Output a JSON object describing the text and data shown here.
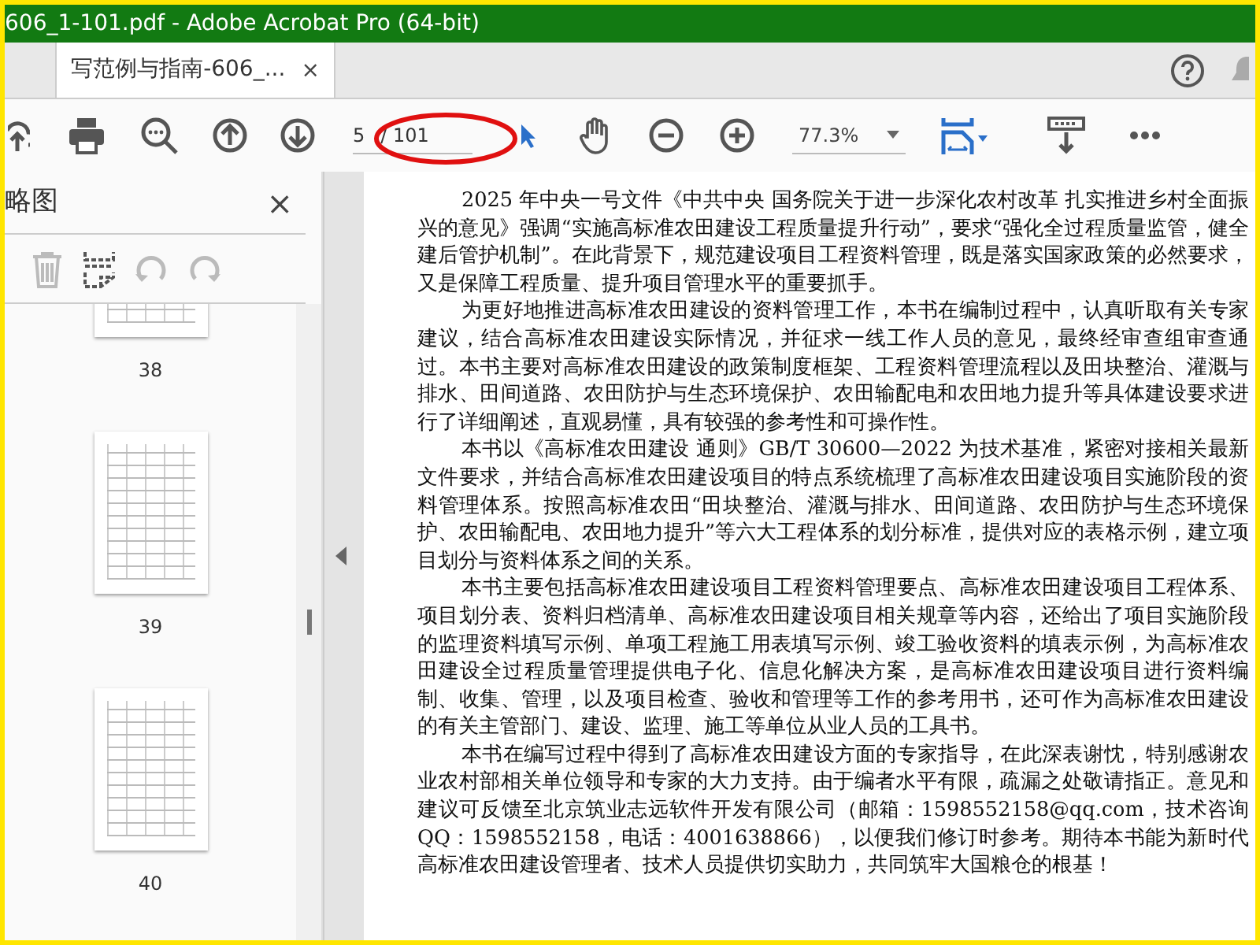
{
  "window": {
    "title": "606_1-101.pdf - Adobe Acrobat Pro (64-bit)"
  },
  "tabs": [
    {
      "label": "写范例与指南-606_...",
      "selected": true,
      "close": "×"
    }
  ],
  "toolbar": {
    "page_number": "5",
    "page_total": "/ 101",
    "zoom": "77.3%"
  },
  "thumbnail_panel": {
    "title": "略图",
    "close": "×",
    "thumbnails": [
      {
        "label": "38"
      },
      {
        "label": "39"
      },
      {
        "label": "40"
      }
    ]
  },
  "document": {
    "paragraphs": [
      "2025 年中央一号文件《中共中央  国务院关于进一步深化农村改革  扎实推进乡村全面振兴的意见》强调“实施高标准农田建设工程质量提升行动”，要求“强化全过程质量监管，健全建后管护机制”。在此背景下，规范建设项目工程资料管理，既是落实国家政策的必然要求，又是保障工程质量、提升项目管理水平的重要抓手。",
      "为更好地推进高标准农田建设的资料管理工作，本书在编制过程中，认真听取有关专家建议，结合高标准农田建设实际情况，并征求一线工作人员的意见，最终经审查组审查通过。本书主要对高标准农田建设的政策制度框架、工程资料管理流程以及田块整治、灌溉与排水、田间道路、农田防护与生态环境保护、农田输配电和农田地力提升等具体建设要求进行了详细阐述，直观易懂，具有较强的参考性和可操作性。",
      "本书以《高标准农田建设  通则》GB/T 30600—2022 为技术基准，紧密对接相关最新文件要求，并结合高标准农田建设项目的特点系统梳理了高标准农田建设项目实施阶段的资料管理体系。按照高标准农田“田块整治、灌溉与排水、田间道路、农田防护与生态环境保护、农田输配电、农田地力提升”等六大工程体系的划分标准，提供对应的表格示例，建立项目划分与资料体系之间的关系。",
      "本书主要包括高标准农田建设项目工程资料管理要点、高标准农田建设项目工程体系、项目划分表、资料归档清单、高标准农田建设项目相关规章等内容，还给出了项目实施阶段的监理资料填写示例、单项工程施工用表填写示例、竣工验收资料的填表示例，为高标准农田建设全过程质量管理提供电子化、信息化解决方案，是高标准农田建设项目进行资料编制、收集、管理，以及项目检查、验收和管理等工作的参考用书，还可作为高标准农田建设的有关主管部门、建设、监理、施工等单位从业人员的工具书。",
      "本书在编写过程中得到了高标准农田建设方面的专家指导，在此深表谢忱，特别感谢农业农村部相关单位领导和专家的大力支持。由于编者水平有限，疏漏之处敬请指正。意见和建议可反馈至北京筑业志远软件开发有限公司（邮箱：1598552158@qq.com，技术咨询 QQ：1598552158，电话：4001638866），以便我们修订时参考。期待本书能为新时代高标准农田建设管理者、技术人员提供切实助力，共同筑牢大国粮仓的根基！"
    ]
  }
}
